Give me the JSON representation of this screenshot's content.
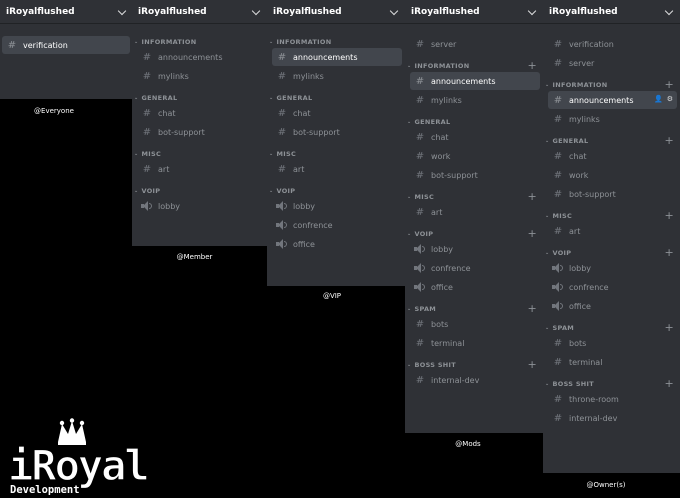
{
  "server_name": "iRoyalflushed",
  "panels": {
    "everyone": {
      "role": "@Everyone",
      "channels": [
        {
          "label": "verification",
          "active": true
        }
      ]
    },
    "member": {
      "role": "@Member",
      "cats": {
        "information": {
          "label": "INFORMATION",
          "channels": [
            "announcements",
            "mylinks"
          ]
        },
        "general": {
          "label": "GENERAL",
          "channels": [
            "chat",
            "bot-support"
          ]
        },
        "misc": {
          "label": "MISC",
          "channels": [
            "art"
          ]
        },
        "voip": {
          "label": "VOIP",
          "channels": [
            "lobby"
          ]
        }
      }
    },
    "vip": {
      "role": "@VIP",
      "cats": {
        "information": {
          "label": "INFORMATION",
          "channels": [
            "announcements",
            "mylinks"
          ]
        },
        "general": {
          "label": "GENERAL",
          "channels": [
            "chat",
            "bot-support"
          ]
        },
        "misc": {
          "label": "MISC",
          "channels": [
            "art"
          ]
        },
        "voip": {
          "label": "VOIP",
          "channels": [
            "lobby",
            "confrence",
            "office"
          ]
        }
      }
    },
    "mods": {
      "role": "@Mods",
      "top": [
        "server"
      ],
      "cats": {
        "information": {
          "label": "INFORMATION",
          "channels": [
            "announcements",
            "mylinks"
          ]
        },
        "general": {
          "label": "GENERAL",
          "channels": [
            "chat",
            "work",
            "bot-support"
          ]
        },
        "misc": {
          "label": "MISC",
          "channels": [
            "art"
          ]
        },
        "voip": {
          "label": "VOIP",
          "channels": [
            "lobby",
            "confrence",
            "office"
          ]
        },
        "spam": {
          "label": "SPAM",
          "channels": [
            "bots",
            "terminal"
          ]
        },
        "boss": {
          "label": "BOSS SHIT",
          "channels": [
            "internal-dev"
          ]
        }
      }
    },
    "owner": {
      "role": "@Owner(s)",
      "top": [
        "verification",
        "server"
      ],
      "cats": {
        "information": {
          "label": "INFORMATION",
          "channels": [
            "announcements",
            "mylinks"
          ]
        },
        "general": {
          "label": "GENERAL",
          "channels": [
            "chat",
            "work",
            "bot-support"
          ]
        },
        "misc": {
          "label": "MISC",
          "channels": [
            "art"
          ]
        },
        "voip": {
          "label": "VOIP",
          "channels": [
            "lobby",
            "confrence",
            "office"
          ]
        },
        "spam": {
          "label": "SPAM",
          "channels": [
            "bots",
            "terminal"
          ]
        },
        "boss": {
          "label": "BOSS SHIT",
          "channels": [
            "throne-room",
            "internal-dev"
          ]
        }
      }
    }
  },
  "logo": {
    "word": "iRoyal",
    "sub": "Development"
  },
  "colors": {
    "panel": "#2f3136",
    "active": "#42464d",
    "muted": "#8e9297",
    "bg": "#000000"
  }
}
